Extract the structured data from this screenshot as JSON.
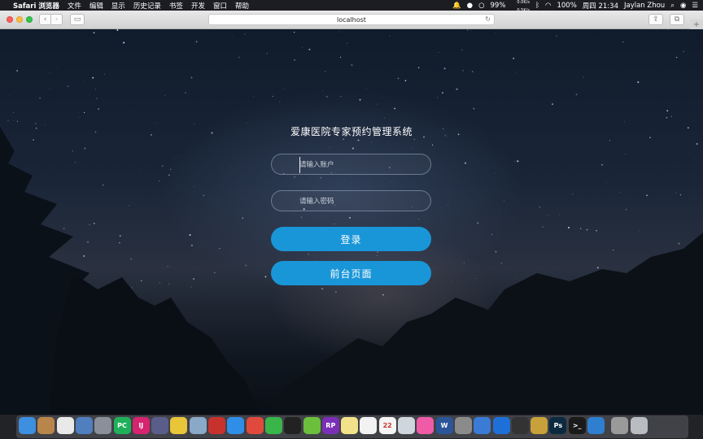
{
  "menubar": {
    "apple": "",
    "app_name": "Safari 浏览器",
    "menus": [
      "文件",
      "编辑",
      "显示",
      "历史记录",
      "书签",
      "开发",
      "窗口",
      "帮助"
    ],
    "battery_percent": "99%",
    "net_up": "0.0K/s",
    "net_down": "0.5K/s",
    "battery2": "100%",
    "clock": "周四 21:34",
    "user": "Jaylan Zhou"
  },
  "browser": {
    "url": "localhost",
    "back_icon": "‹",
    "forward_icon": "›",
    "sidebar_icon": "▭",
    "reload_icon": "↻",
    "share_icon": "⇪",
    "tabs_icon": "⧉",
    "newtab_icon": "+"
  },
  "page": {
    "title": "爱康医院专家预约管理系统",
    "username_placeholder": "请输入账户",
    "password_placeholder": "请输入密码",
    "login_label": "登录",
    "front_label": "前台页面"
  },
  "dock": {
    "icons": [
      {
        "name": "finder-icon",
        "color": "#3d8fe0",
        "glyph": ""
      },
      {
        "name": "notes-book-icon",
        "color": "#b8864a",
        "glyph": ""
      },
      {
        "name": "photos-icon",
        "color": "#e9e9e9",
        "glyph": ""
      },
      {
        "name": "preview-icon",
        "color": "#4f7fbf",
        "glyph": ""
      },
      {
        "name": "launchpad-icon",
        "color": "#8a8f99",
        "glyph": ""
      },
      {
        "name": "pycharm-icon",
        "color": "#20b05a",
        "glyph": "PC"
      },
      {
        "name": "intellij-icon",
        "color": "#d6246f",
        "glyph": "IJ"
      },
      {
        "name": "sublime-icon",
        "color": "#5a5d8a",
        "glyph": ""
      },
      {
        "name": "sequel-icon",
        "color": "#e9c53a",
        "glyph": ""
      },
      {
        "name": "database-icon",
        "color": "#8aa8c8",
        "glyph": ""
      },
      {
        "name": "redis-icon",
        "color": "#c8322d",
        "glyph": ""
      },
      {
        "name": "safari-icon",
        "color": "#2f8fe8",
        "glyph": ""
      },
      {
        "name": "screen-icon",
        "color": "#e04a3c",
        "glyph": ""
      },
      {
        "name": "wechat-icon",
        "color": "#39b54a",
        "glyph": ""
      },
      {
        "name": "qq-icon",
        "color": "#222222",
        "glyph": ""
      },
      {
        "name": "maps-icon",
        "color": "#6cbf3c",
        "glyph": ""
      },
      {
        "name": "axure-rp-icon",
        "color": "#7b2fb8",
        "glyph": "RP"
      },
      {
        "name": "stickies-icon",
        "color": "#f2e38a",
        "glyph": ""
      },
      {
        "name": "textedit-icon",
        "color": "#f2f2f2",
        "glyph": ""
      },
      {
        "name": "calendar-icon",
        "color": "#f4f4f4",
        "glyph": "22"
      },
      {
        "name": "image-viewer-icon",
        "color": "#cfd6dd",
        "glyph": ""
      },
      {
        "name": "itunes-icon",
        "color": "#f05ba8",
        "glyph": ""
      },
      {
        "name": "word-icon",
        "color": "#2a5699",
        "glyph": "W"
      },
      {
        "name": "system-preferences-icon",
        "color": "#8b8b8b",
        "glyph": ""
      },
      {
        "name": "baidu-netdisk-icon",
        "color": "#3a7bd5",
        "glyph": ""
      },
      {
        "name": "teamviewer-icon",
        "color": "#1f6fd8",
        "glyph": ""
      },
      {
        "name": "qq-2-icon",
        "color": "#333333",
        "glyph": ""
      },
      {
        "name": "sketch-icon",
        "color": "#c9a13a",
        "glyph": ""
      },
      {
        "name": "photoshop-icon",
        "color": "#0b2a40",
        "glyph": "Ps"
      },
      {
        "name": "terminal-icon",
        "color": "#1a1a1a",
        "glyph": ">_"
      },
      {
        "name": "edge-icon",
        "color": "#2f7fd0",
        "glyph": ""
      },
      {
        "name": "music-folder-icon",
        "color": "#9a9a9a",
        "glyph": ""
      },
      {
        "name": "trash-icon",
        "color": "#b9bcc1",
        "glyph": ""
      }
    ]
  }
}
